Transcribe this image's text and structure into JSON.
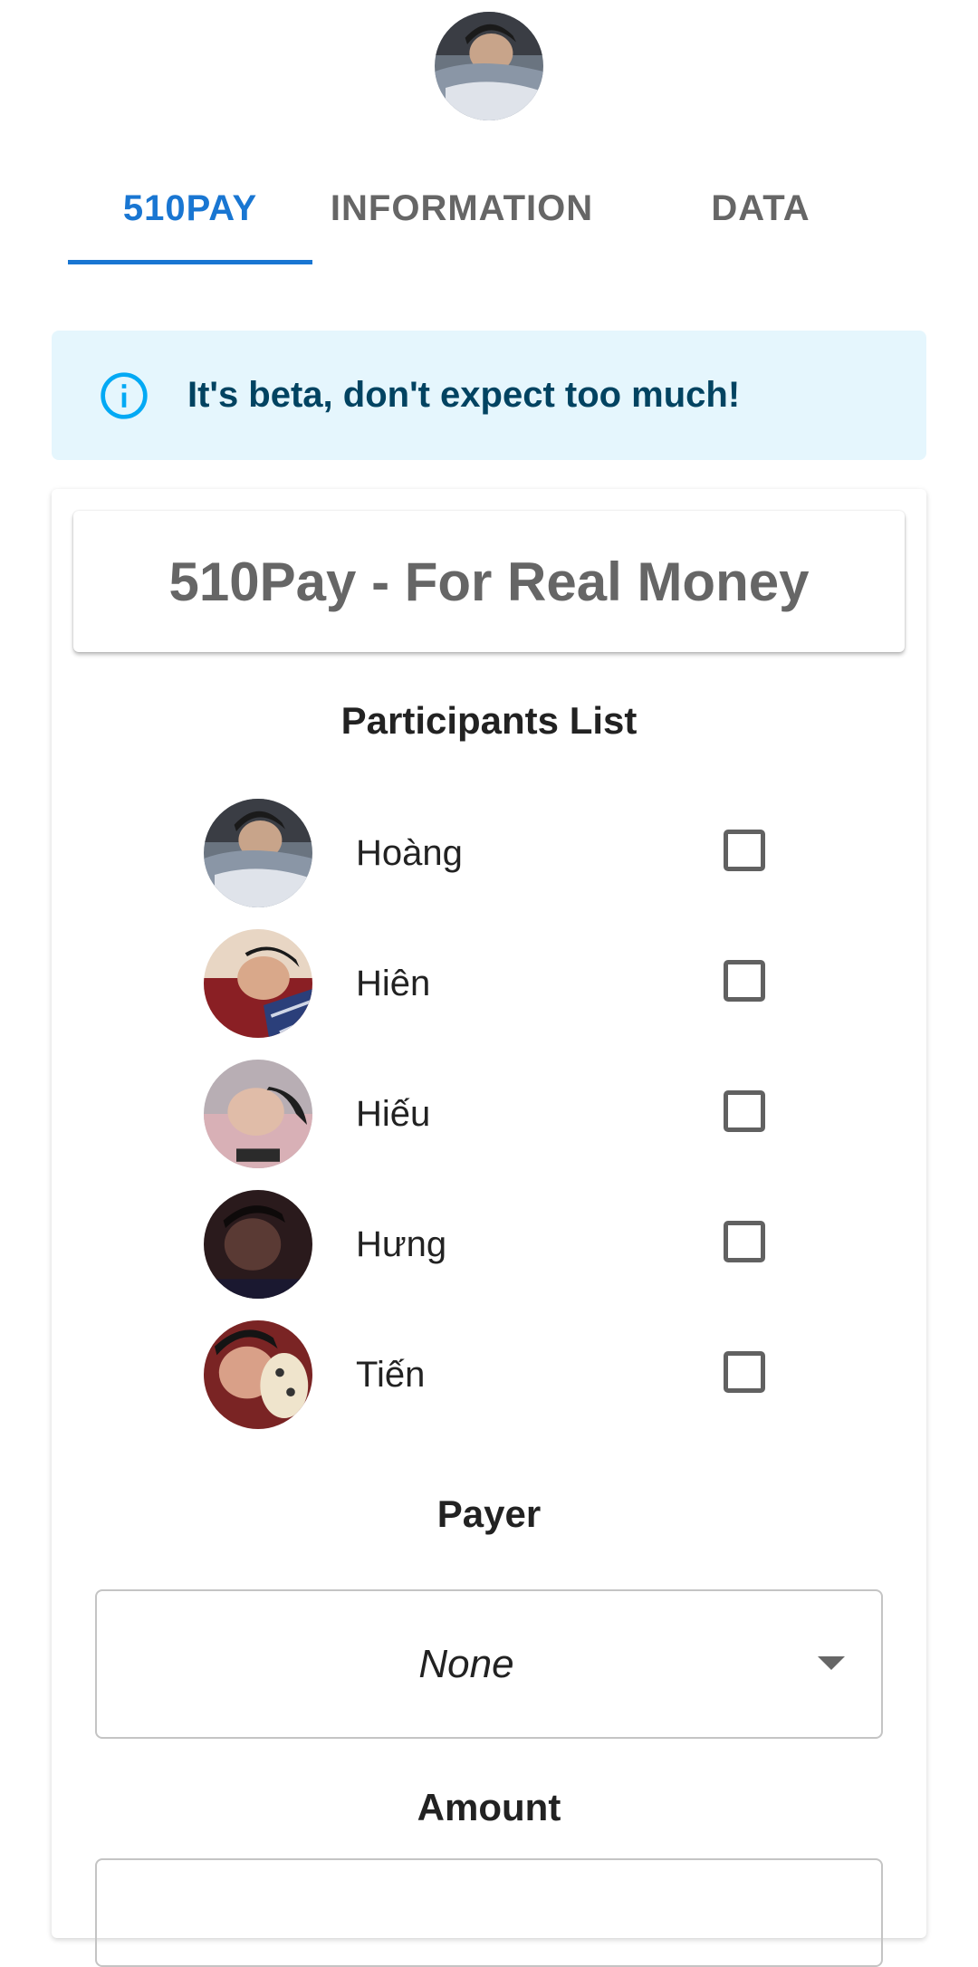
{
  "header": {
    "avatar_icon": "user-avatar-photo"
  },
  "tabs": [
    {
      "label": "510PAY",
      "active": true
    },
    {
      "label": "INFORMATION",
      "active": false
    },
    {
      "label": "DATA",
      "active": false
    }
  ],
  "alert": {
    "icon": "info-icon",
    "text": "It's beta, don't expect too much!",
    "background": "#e5f6fd",
    "text_color": "#014361",
    "icon_color": "#03a9f4"
  },
  "card": {
    "title": "510Pay - For Real Money",
    "participants_heading": "Participants List",
    "participants": [
      {
        "name": "Hoàng",
        "checked": false
      },
      {
        "name": "Hiên",
        "checked": false
      },
      {
        "name": "Hiếu",
        "checked": false
      },
      {
        "name": "Hưng",
        "checked": false
      },
      {
        "name": "Tiến",
        "checked": false
      }
    ],
    "payer_heading": "Payer",
    "payer_value": "None",
    "amount_heading": "Amount",
    "amount_value": ""
  },
  "colors": {
    "accent": "#1976d2",
    "tab_inactive": "#666666"
  }
}
